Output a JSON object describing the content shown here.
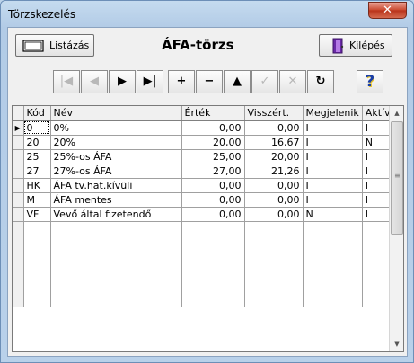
{
  "window": {
    "title": "Törzskezelés",
    "close_glyph": "✕"
  },
  "toolbar": {
    "list_label": "Listázás",
    "page_title": "ÁFA-törzs",
    "exit_label": "Kilépés",
    "nav_buttons": [
      {
        "name": "first-record-button",
        "icon": "first-icon",
        "glyph": "|◀",
        "enabled": false
      },
      {
        "name": "prior-record-button",
        "icon": "prior-icon",
        "glyph": "◀",
        "enabled": false
      },
      {
        "name": "next-record-button",
        "icon": "next-icon",
        "glyph": "▶",
        "enabled": true
      },
      {
        "name": "last-record-button",
        "icon": "last-icon",
        "glyph": "▶|",
        "enabled": true
      },
      {
        "name": "insert-record-button",
        "icon": "plus-icon",
        "glyph": "+",
        "enabled": true
      },
      {
        "name": "delete-record-button",
        "icon": "minus-icon",
        "glyph": "−",
        "enabled": true
      },
      {
        "name": "edit-record-button",
        "icon": "up-triangle-icon",
        "glyph": "▲",
        "enabled": true
      },
      {
        "name": "post-edit-button",
        "icon": "checkmark-icon",
        "glyph": "✓",
        "enabled": false
      },
      {
        "name": "cancel-edit-button",
        "icon": "cross-icon",
        "glyph": "✕",
        "enabled": false
      },
      {
        "name": "refresh-button",
        "icon": "refresh-icon",
        "glyph": "↻",
        "enabled": true
      }
    ],
    "help_glyph": "?"
  },
  "grid": {
    "columns": [
      "Kód",
      "Név",
      "Érték",
      "Visszért.",
      "Megjelenik",
      "Aktív"
    ],
    "rows": [
      [
        "0",
        "0%",
        "0,00",
        "0,00",
        "I",
        "I"
      ],
      [
        "20",
        "20%",
        "20,00",
        "16,67",
        "I",
        "N"
      ],
      [
        "25",
        "25%-os ÁFA",
        "25,00",
        "20,00",
        "I",
        "I"
      ],
      [
        "27",
        "27%-os ÁFA",
        "27,00",
        "21,26",
        "I",
        "I"
      ],
      [
        "HK",
        "ÁFA tv.hat.kívüli",
        "0,00",
        "0,00",
        "I",
        "I"
      ],
      [
        "M",
        "ÁFA mentes",
        "0,00",
        "0,00",
        "I",
        "I"
      ],
      [
        "VF",
        "Vevő által fizetendő",
        "0,00",
        "0,00",
        "N",
        "I"
      ]
    ],
    "current_row_indicator": "▶",
    "empty_row_count": 6
  },
  "scrollbar": {
    "up_glyph": "▲",
    "down_glyph": "▼",
    "grip_glyph": "≡"
  }
}
